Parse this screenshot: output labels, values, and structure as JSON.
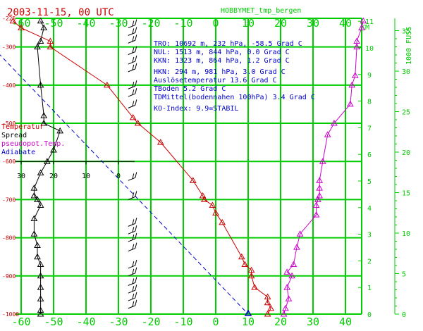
{
  "header": {
    "date_title": "2003-11-15, 00 UTC",
    "station_title": "HOBBYMET_tmp_bergen"
  },
  "colors": {
    "grid": "#00cc00",
    "temperature": "#cc0000",
    "spread": "#000000",
    "pseudopot": "#cc00cc",
    "adiabate": "#0000cc",
    "info_text": "#0000cc"
  },
  "axes": {
    "temp_ticks": [
      "-60",
      "-50",
      "-40",
      "-30",
      "-20",
      "-10",
      "0",
      "10",
      "20",
      "30",
      "40"
    ],
    "pressure_ticks": [
      "-225",
      "-300",
      "-400",
      "-500",
      "-600",
      "-700",
      "-800",
      "-900",
      "-1000"
    ],
    "km_ticks": [
      "0",
      "1",
      "2",
      "3",
      "4",
      "5",
      "6",
      "7",
      "8",
      "9",
      "10",
      "11"
    ],
    "km_label": "KM",
    "fuss_ticks": [
      "0",
      "5",
      "10",
      "15",
      "20",
      "25",
      "30",
      "35"
    ],
    "fuss_label": "1000 FUSS",
    "spread_ticks": [
      "30",
      "20",
      "10",
      "0"
    ]
  },
  "info": [
    "TRO:     10692 m,  232 hPa, -58.5 Grad C",
    "NUL:      1513 m,  844 hPa,   0.0 Grad C",
    "KKN:      1323 m,  864 hPa,   1.2 Grad C",
    "HKN:       294 m,  981 hPa,   3.0 Grad C",
    "Auslösetemperatur              13.6 Grad C",
    "TBoden                          5.2 Grad C",
    "TDMittel(bodennahen 100hPa)     3.4 Grad C",
    "KO-Index:  9.9=STABIL"
  ],
  "legend": [
    "Temperatur",
    "Spread",
    "pseudopot.Temp.",
    "Adiabate"
  ],
  "chart_data": {
    "type": "line",
    "xlabel": "",
    "ylabel": "",
    "xlim": [
      -60,
      45
    ],
    "ylim_hpa": [
      1000,
      225
    ],
    "series": [
      {
        "name": "Temperatur",
        "points": [
          [
            -62.5,
            232
          ],
          [
            -60,
            250
          ],
          [
            -51,
            285
          ],
          [
            -51,
            300
          ],
          [
            -33.5,
            400
          ],
          [
            -25.5,
            485
          ],
          [
            -24,
            500
          ],
          [
            -17,
            550
          ],
          [
            -7,
            650
          ],
          [
            -4,
            690
          ],
          [
            -3.5,
            700
          ],
          [
            -1,
            715
          ],
          [
            0,
            735
          ],
          [
            2,
            760
          ],
          [
            8,
            850
          ],
          [
            9,
            870
          ],
          [
            11,
            885
          ],
          [
            11,
            900
          ],
          [
            12,
            930
          ],
          [
            16,
            955
          ],
          [
            16,
            970
          ],
          [
            17,
            985
          ],
          [
            16,
            1000
          ]
        ]
      },
      {
        "name": "Spread",
        "points": [
          [
            24,
            232
          ],
          [
            23,
            250
          ],
          [
            24,
            285
          ],
          [
            25,
            300
          ],
          [
            24,
            400
          ],
          [
            23,
            480
          ],
          [
            23,
            500
          ],
          [
            18,
            520
          ],
          [
            20,
            570
          ],
          [
            22,
            600
          ],
          [
            24,
            630
          ],
          [
            26,
            670
          ],
          [
            26,
            690
          ],
          [
            25,
            700
          ],
          [
            24,
            715
          ],
          [
            26,
            750
          ],
          [
            26,
            790
          ],
          [
            25,
            820
          ],
          [
            25,
            850
          ],
          [
            24,
            870
          ],
          [
            24,
            900
          ],
          [
            24,
            930
          ],
          [
            24,
            960
          ],
          [
            24,
            990
          ],
          [
            24,
            1000
          ]
        ]
      },
      {
        "name": "pseudopot.Temp.",
        "points": [
          [
            45.5,
            232
          ],
          [
            45,
            250
          ],
          [
            43.5,
            285
          ],
          [
            43.5,
            300
          ],
          [
            43,
            375
          ],
          [
            42,
            400
          ],
          [
            41.5,
            450
          ],
          [
            36.5,
            500
          ],
          [
            34.5,
            530
          ],
          [
            33,
            600
          ],
          [
            32,
            650
          ],
          [
            32,
            670
          ],
          [
            32,
            690
          ],
          [
            31.5,
            700
          ],
          [
            31,
            715
          ],
          [
            31,
            740
          ],
          [
            26,
            790
          ],
          [
            25,
            825
          ],
          [
            24,
            870
          ],
          [
            22,
            890
          ],
          [
            23.5,
            900
          ],
          [
            22,
            930
          ],
          [
            22.5,
            960
          ],
          [
            21.5,
            985
          ],
          [
            21,
            1000
          ]
        ]
      },
      {
        "name": "Adiabate",
        "points": [
          [
            -70,
            290
          ],
          [
            10,
            1000
          ]
        ]
      }
    ]
  }
}
